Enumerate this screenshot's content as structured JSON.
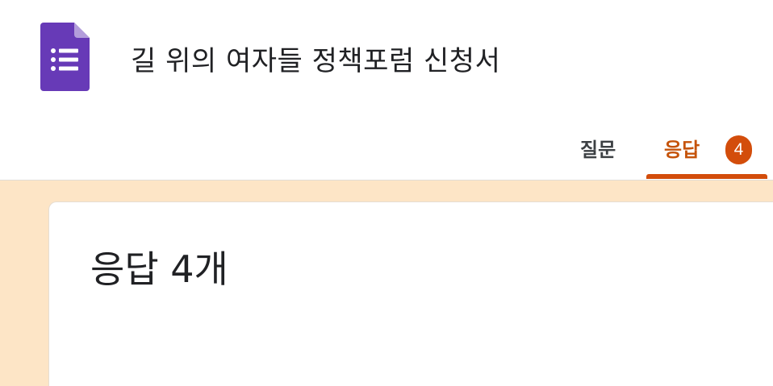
{
  "header": {
    "title": "길 위의 여자들 정책포럼 신청서",
    "icon": "google-forms-icon"
  },
  "tabs": [
    {
      "label": "질문",
      "active": false
    },
    {
      "label": "응답",
      "active": true,
      "badge": "4"
    }
  ],
  "summary": {
    "title": "응답 4개"
  },
  "colors": {
    "accent": "#d34d0b",
    "active_tab_text": "#c5530a",
    "background": "#fde5c6",
    "forms_purple": "#673ab7"
  }
}
